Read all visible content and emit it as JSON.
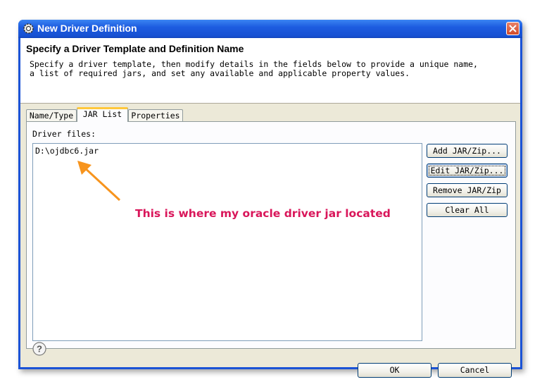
{
  "window": {
    "title": "New Driver Definition",
    "title_icon": "gear-icon",
    "close_icon": "close-icon"
  },
  "banner": {
    "title": "Specify a Driver Template and Definition Name",
    "description": "Specify a driver template, then modify details in the fields below to provide a unique name, a list of required jars, and set any available and applicable property values."
  },
  "tabs": [
    {
      "label": "Name/Type",
      "active": false
    },
    {
      "label": "JAR List",
      "active": true
    },
    {
      "label": "Properties",
      "active": false
    }
  ],
  "jar_list": {
    "label": "Driver files:",
    "files": [
      "D:\\ojdbc6.jar"
    ],
    "buttons": {
      "add": "Add JAR/Zip...",
      "edit": "Edit JAR/Zip...",
      "remove": "Remove JAR/Zip",
      "clear": "Clear All"
    }
  },
  "annotation": {
    "text": "This is where my oracle driver jar located",
    "color": "#d9165a",
    "arrow_color": "#f7941d"
  },
  "footer": {
    "help_icon": "help-icon",
    "ok": "OK",
    "cancel": "Cancel"
  }
}
